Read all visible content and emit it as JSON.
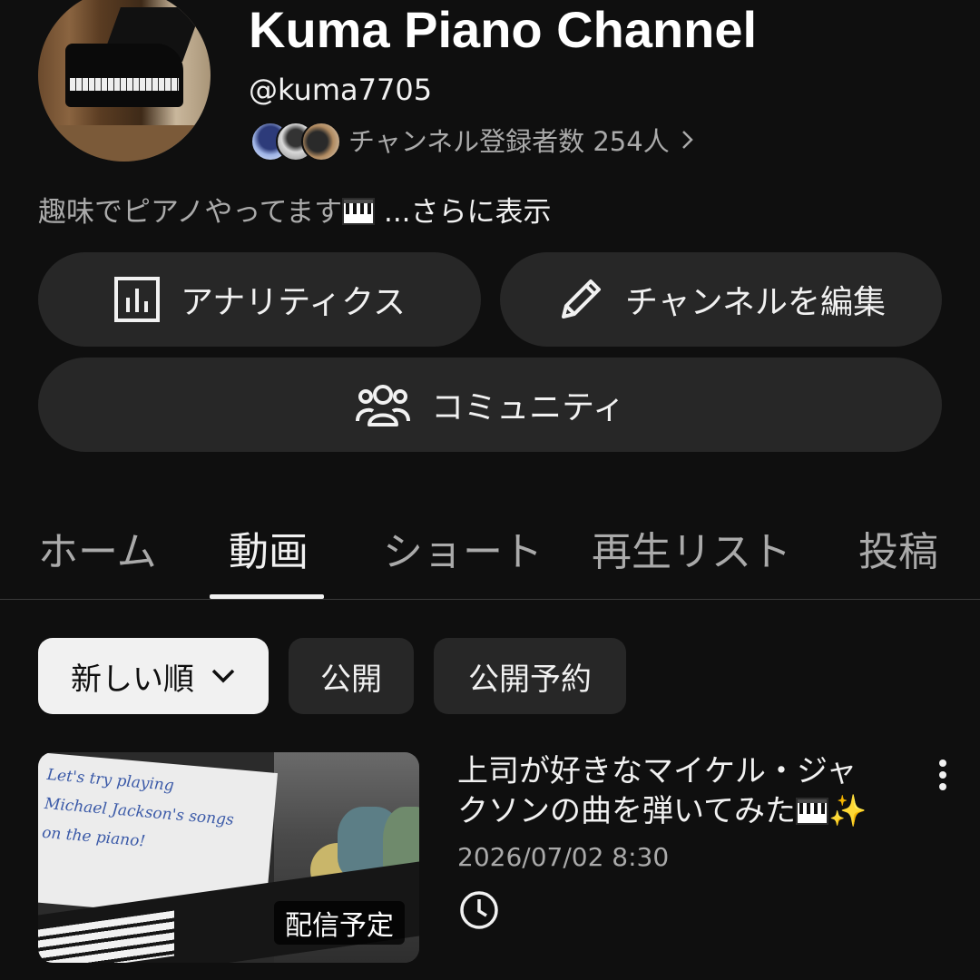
{
  "channel": {
    "name": "Kuma Piano Channel",
    "handle": "@kuma7705",
    "subscribers_text": "チャンネル登録者数 254人",
    "description": "趣味でピアノやってます",
    "description_more": " ...さらに表示"
  },
  "buttons": {
    "analytics": "アナリティクス",
    "edit_channel": "チャンネルを編集",
    "community": "コミュニティ"
  },
  "tabs": [
    {
      "label": "ホーム",
      "active": false
    },
    {
      "label": "動画",
      "active": true
    },
    {
      "label": "ショート",
      "active": false
    },
    {
      "label": "再生リスト",
      "active": false
    },
    {
      "label": "投稿",
      "active": false
    }
  ],
  "filters": {
    "sort": "新しい順",
    "public": "公開",
    "scheduled": "公開予約"
  },
  "video": {
    "title_line1": "上司が好きなマイケル・ジャ",
    "title_line2": "クソンの曲を弾いてみた",
    "date": "2026/07/02 8:30",
    "badge": "配信予定",
    "thumb_text": [
      "Let's try playing",
      "Michael Jackson's songs",
      "on the piano!"
    ]
  },
  "icons": {
    "analytics": "bar-chart-icon",
    "edit": "pencil-icon",
    "community": "people-icon",
    "sort": "chevron-down-icon",
    "clock": "clock-icon",
    "more": "more-vert-icon"
  },
  "colors": {
    "background": "#0f0f0f",
    "pill": "#272727",
    "text_primary": "#f1f1f1",
    "text_secondary": "#aaaaaa"
  }
}
